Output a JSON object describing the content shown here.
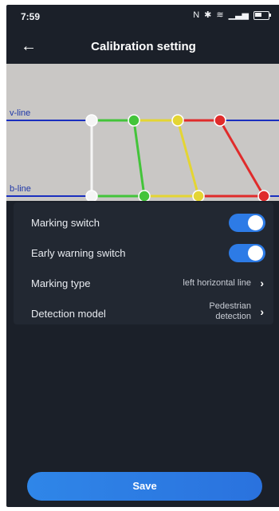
{
  "status": {
    "time": "7:59"
  },
  "header": {
    "title": "Calibration setting"
  },
  "camera": {
    "vline_label": "v-line",
    "bline_label": "b-line"
  },
  "settings": {
    "marking_switch": {
      "label": "Marking switch",
      "on": true
    },
    "early_warning_switch": {
      "label": "Early warning switch",
      "on": true
    },
    "marking_type": {
      "label": "Marking type",
      "value": "left horizontal line"
    },
    "detection_model": {
      "label": "Detection model",
      "value_line1": "Pedestrian",
      "value_line2": "detection"
    }
  },
  "footer": {
    "save_label": "Save"
  },
  "colors": {
    "accent": "#2d7be6",
    "background": "#1b2029",
    "panel": "#222832"
  }
}
